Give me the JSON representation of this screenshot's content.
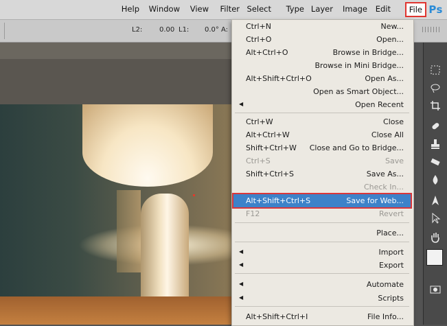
{
  "app": {
    "logo_text": "Ps",
    "accent_color": "#2a8bd7"
  },
  "menubar": {
    "items": [
      "File",
      "Edit",
      "Image",
      "Layer",
      "Type",
      "Select",
      "Filter",
      "View",
      "Window",
      "Help"
    ],
    "active": "File"
  },
  "options_bar": {
    "values": [
      "A:",
      "0.0°",
      "L1:",
      "0.00",
      "L2:"
    ]
  },
  "file_menu": {
    "items": [
      {
        "label": "New...",
        "shortcut": "Ctrl+N"
      },
      {
        "label": "Open...",
        "shortcut": "Ctrl+O"
      },
      {
        "label": "Browse in Bridge...",
        "shortcut": "Alt+Ctrl+O"
      },
      {
        "label": "Browse in Mini Bridge...",
        "shortcut": ""
      },
      {
        "label": "Open As...",
        "shortcut": "Alt+Shift+Ctrl+O"
      },
      {
        "label": "Open as Smart Object...",
        "shortcut": ""
      },
      {
        "label": "Open Recent",
        "shortcut": "",
        "submenu": true
      },
      {
        "label": "Close",
        "shortcut": "Ctrl+W"
      },
      {
        "label": "Close All",
        "shortcut": "Alt+Ctrl+W"
      },
      {
        "label": "Close and Go to Bridge...",
        "shortcut": "Shift+Ctrl+W"
      },
      {
        "label": "Save",
        "shortcut": "Ctrl+S",
        "disabled": true
      },
      {
        "label": "Save As...",
        "shortcut": "Shift+Ctrl+S"
      },
      {
        "label": "Check In...",
        "shortcut": "",
        "disabled": true
      },
      {
        "label": "Save for Web...",
        "shortcut": "Alt+Shift+Ctrl+S",
        "highlighted": true
      },
      {
        "label": "Revert",
        "shortcut": "F12",
        "disabled": true
      },
      {
        "label": "Place...",
        "shortcut": ""
      },
      {
        "label": "Import",
        "shortcut": "",
        "submenu": true
      },
      {
        "label": "Export",
        "shortcut": "",
        "submenu": true
      },
      {
        "label": "Automate",
        "shortcut": "",
        "submenu": true
      },
      {
        "label": "Scripts",
        "shortcut": "",
        "submenu": true
      },
      {
        "label": "File Info...",
        "shortcut": "Alt+Shift+Ctrl+I"
      }
    ]
  },
  "tools": [
    "marquee-icon",
    "lasso-icon",
    "crop-icon",
    "healing-brush-icon",
    "stamp-icon",
    "eraser-icon",
    "blur-icon",
    "pen-icon",
    "path-select-icon",
    "hand-icon"
  ],
  "colors": {
    "highlight": "#3d82c9",
    "callout_border": "#d9363a"
  }
}
